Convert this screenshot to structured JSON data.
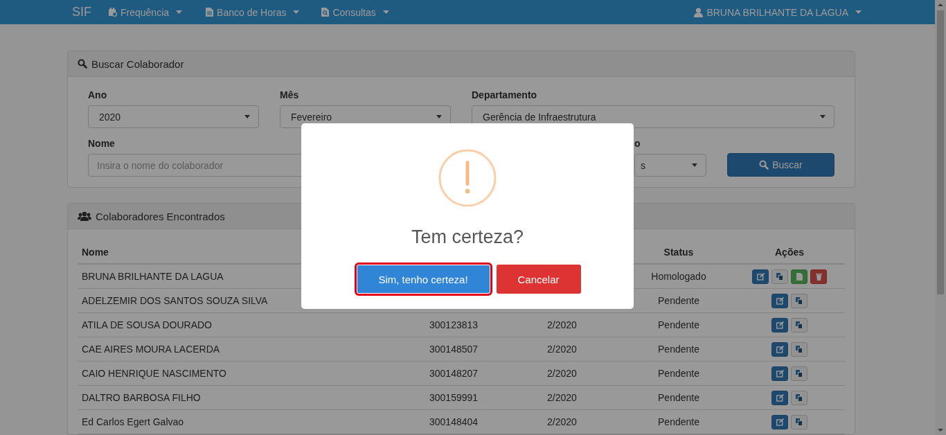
{
  "navbar": {
    "brand": "SIF",
    "menus": [
      {
        "label": "Frequência"
      },
      {
        "label": "Banco de Horas"
      },
      {
        "label": "Consultas"
      }
    ],
    "user": "BRUNA BRILHANTE DA LAGUA"
  },
  "search_panel": {
    "title": "Buscar Colaborador",
    "fields": [
      {
        "label": "Ano",
        "kind": "select",
        "value": "2020"
      },
      {
        "label": "Mês",
        "kind": "select",
        "value": "Fevereiro"
      },
      {
        "label": "Departamento",
        "kind": "select",
        "value": "Gerência de Infraestrutura"
      },
      {
        "label": "Nome",
        "kind": "text",
        "placeholder": "Insira o nome do colaborador"
      },
      {
        "label": "o",
        "kind": "select",
        "value": "s"
      }
    ],
    "button": "Buscar"
  },
  "results_panel": {
    "title": "Colaboradores Encontrados",
    "headers": {
      "name": "Nome",
      "status": "Status",
      "actions": "Ações"
    },
    "rows": [
      {
        "name": "BRUNA BRILHANTE DA LAGUA",
        "status": "Homologado",
        "actions": [
          {
            "kind": "edit"
          },
          {
            "kind": "copy"
          },
          {
            "kind": "pdf"
          },
          {
            "kind": "delete"
          }
        ]
      },
      {
        "name": "ADELZEMIR DOS SANTOS SOUZA SILVA",
        "status": "Pendente",
        "actions": [
          {
            "kind": "edit"
          },
          {
            "kind": "copy"
          }
        ]
      },
      {
        "name": "ATILA DE SOUSA DOURADO",
        "column_2": "300123813",
        "column_3": "2/2020",
        "status": "Pendente",
        "actions": [
          {
            "kind": "edit"
          },
          {
            "kind": "copy"
          }
        ]
      },
      {
        "name": "CAE AIRES MOURA LACERDA",
        "column_2": "300148507",
        "column_3": "2/2020",
        "status": "Pendente",
        "actions": [
          {
            "kind": "edit"
          },
          {
            "kind": "copy"
          }
        ]
      },
      {
        "name": "CAIO HENRIQUE NASCIMENTO",
        "column_2": "300148207",
        "column_3": "2/2020",
        "status": "Pendente",
        "actions": [
          {
            "kind": "edit"
          },
          {
            "kind": "copy"
          }
        ]
      },
      {
        "name": "DALTRO BARBOSA FILHO",
        "column_2": "300159991",
        "column_3": "2/2020",
        "status": "Pendente",
        "actions": [
          {
            "kind": "edit"
          },
          {
            "kind": "copy"
          }
        ]
      },
      {
        "name": "Ed Carlos Egert Galvao",
        "column_2": "300148404",
        "column_3": "2/2020",
        "status": "Pendente",
        "actions": [
          {
            "kind": "edit"
          },
          {
            "kind": "copy"
          }
        ]
      }
    ]
  },
  "modal": {
    "title": "Tem certeza?",
    "buttons": [
      {
        "label": "Sim, tenho certeza!",
        "kind": "confirm",
        "focused": true
      },
      {
        "label": "Cancelar",
        "kind": "cancel",
        "focused": false
      }
    ]
  }
}
